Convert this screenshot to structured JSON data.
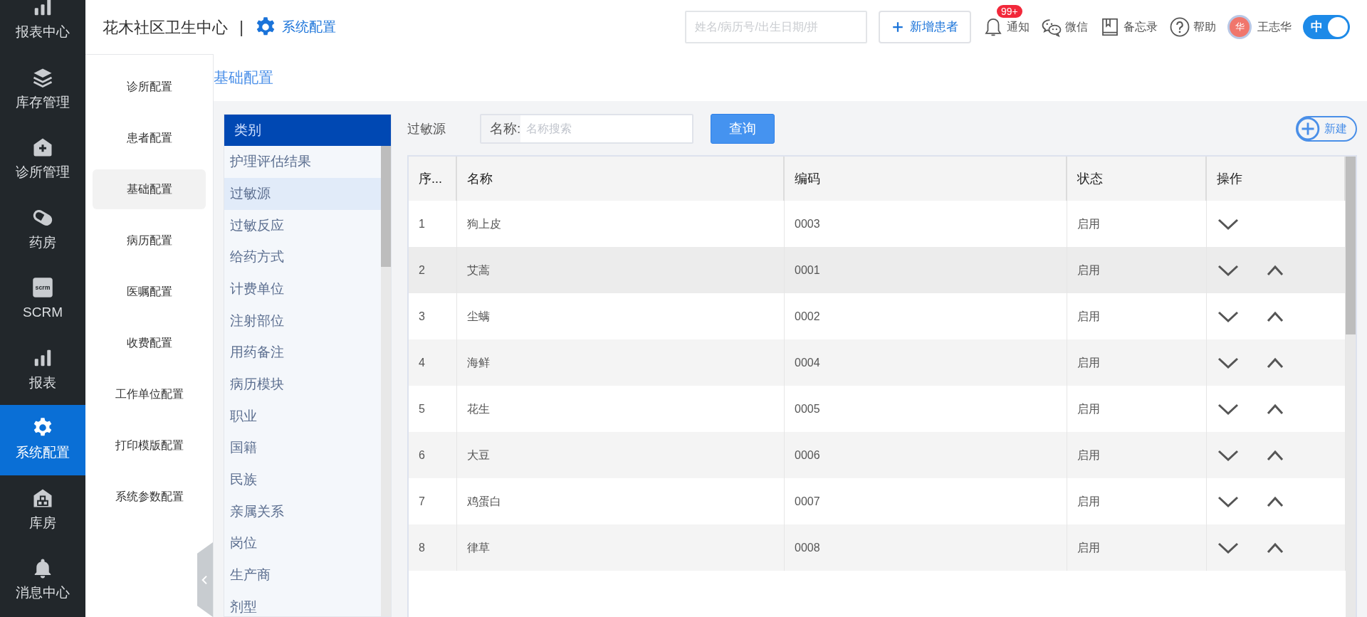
{
  "nav": {
    "items": [
      {
        "label": "报表中心",
        "selected": false
      },
      {
        "label": "库存管理",
        "selected": false
      },
      {
        "label": "诊所管理",
        "selected": false
      },
      {
        "label": "药房",
        "selected": false
      },
      {
        "label": "SCRM",
        "icon_text": "scrm",
        "selected": false
      },
      {
        "label": "报表",
        "selected": false
      },
      {
        "label": "系统配置",
        "selected": true
      },
      {
        "label": "库房",
        "selected": false
      },
      {
        "label": "消息中心",
        "selected": false
      }
    ]
  },
  "header": {
    "clinic": "花木社区卫生中心",
    "separator": "|",
    "section": "系统配置",
    "search": {
      "placeholder": "姓名/病历号/出生日期/拼"
    },
    "add_button": "新增患者",
    "tools": [
      {
        "label": "通知",
        "badge": "99+"
      },
      {
        "label": "微信"
      },
      {
        "label": "备忘录"
      },
      {
        "label": "帮助"
      }
    ],
    "user": {
      "avatar": "华",
      "name": "王志华"
    },
    "toggle": {
      "label": "中",
      "on": true
    }
  },
  "config_menu": [
    {
      "label": "诊所配置",
      "selected": false
    },
    {
      "label": "患者配置",
      "selected": false
    },
    {
      "label": "基础配置",
      "selected": true
    },
    {
      "label": "病历配置",
      "selected": false
    },
    {
      "label": "医嘱配置",
      "selected": false
    },
    {
      "label": "收费配置",
      "selected": false
    },
    {
      "label": "工作单位配置",
      "selected": false
    },
    {
      "label": "打印模版配置",
      "selected": false
    },
    {
      "label": "系统参数配置",
      "selected": false
    }
  ],
  "page_title": "基础配置",
  "categories": {
    "header": "类别",
    "items": [
      {
        "label": "护理评估结果",
        "selected": false
      },
      {
        "label": "过敏源",
        "selected": true
      },
      {
        "label": "过敏反应",
        "selected": false
      },
      {
        "label": "给药方式",
        "selected": false
      },
      {
        "label": "计费单位",
        "selected": false
      },
      {
        "label": "注射部位",
        "selected": false
      },
      {
        "label": "用药备注",
        "selected": false
      },
      {
        "label": "病历模块",
        "selected": false
      },
      {
        "label": "职业",
        "selected": false
      },
      {
        "label": "国籍",
        "selected": false
      },
      {
        "label": "民族",
        "selected": false
      },
      {
        "label": "亲属关系",
        "selected": false
      },
      {
        "label": "岗位",
        "selected": false
      },
      {
        "label": "生产商",
        "selected": false
      },
      {
        "label": "剂型",
        "selected": false
      }
    ]
  },
  "filter": {
    "title": "过敏源",
    "field_label": "名称:",
    "placeholder": "名称搜索",
    "query_button": "查询",
    "new_button": "新建"
  },
  "table": {
    "columns": [
      "序...",
      "名称",
      "编码",
      "状态",
      "操作"
    ],
    "rows": [
      {
        "index": "1",
        "name": "狗上皮",
        "code": "0003",
        "status": "启用",
        "highlighted": false,
        "can_move_up": false
      },
      {
        "index": "2",
        "name": "艾蒿",
        "code": "0001",
        "status": "启用",
        "highlighted": true,
        "can_move_up": true
      },
      {
        "index": "3",
        "name": "尘螨",
        "code": "0002",
        "status": "启用",
        "highlighted": false,
        "can_move_up": true
      },
      {
        "index": "4",
        "name": "海鲜",
        "code": "0004",
        "status": "启用",
        "highlighted": false,
        "can_move_up": true
      },
      {
        "index": "5",
        "name": "花生",
        "code": "0005",
        "status": "启用",
        "highlighted": false,
        "can_move_up": true
      },
      {
        "index": "6",
        "name": "大豆",
        "code": "0006",
        "status": "启用",
        "highlighted": false,
        "can_move_up": true
      },
      {
        "index": "7",
        "name": "鸡蛋白",
        "code": "0007",
        "status": "启用",
        "highlighted": false,
        "can_move_up": true
      },
      {
        "index": "8",
        "name": "律草",
        "code": "0008",
        "status": "启用",
        "highlighted": false,
        "can_move_up": true
      }
    ]
  }
}
